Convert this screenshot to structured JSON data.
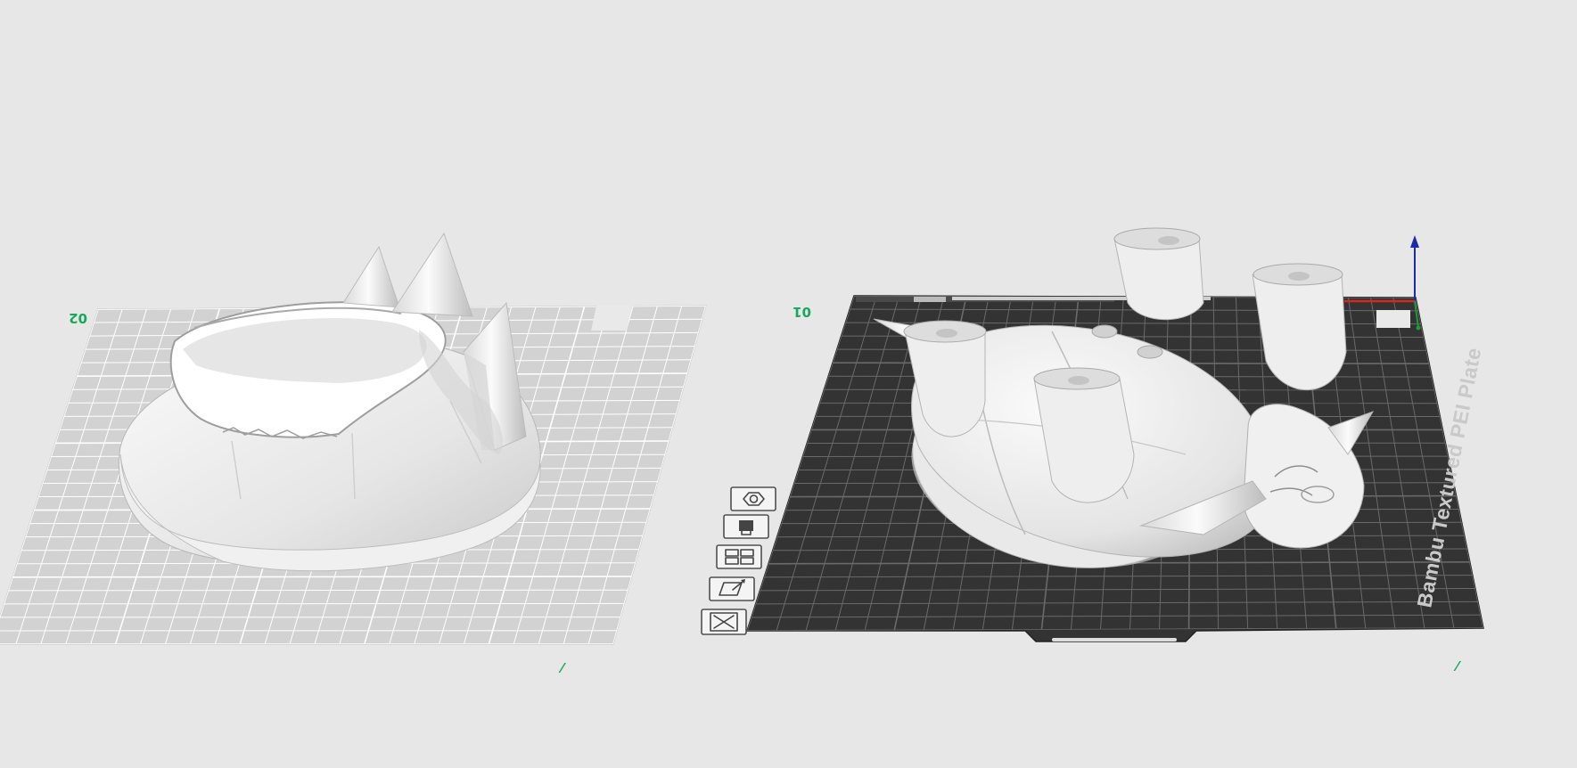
{
  "app": {
    "view": "3D prepare view"
  },
  "colors": {
    "background": "#e7e7e7",
    "plate_grey": "#d2d2d2",
    "plate_dark": "#333333",
    "plate_grid_light": "#ffffff",
    "plate_grid_dark": "#6a6a6a",
    "label_green": "#17a85a",
    "model": "#eaeaea",
    "axis_x": "#d42a1e",
    "axis_y": "#1f9a3a",
    "axis_z": "#1a2aa8"
  },
  "plates": [
    {
      "index_label": "02",
      "corner_label": "⁄",
      "state": "inactive",
      "model": "crown-shell"
    },
    {
      "index_label": "01",
      "corner_label": "⁄",
      "state": "active",
      "brand_text": "Bambu Textured PEI Plate",
      "model": "shell-body-with-legs"
    }
  ],
  "plate_toolbar": [
    {
      "icon": "arrange-icon",
      "label": "Arrange"
    },
    {
      "icon": "lock-icon",
      "label": "Lock"
    },
    {
      "icon": "settings-icon",
      "label": "Plate settings"
    },
    {
      "icon": "auto-orient-icon",
      "label": "Auto orient"
    },
    {
      "icon": "close-icon",
      "label": "Delete plate"
    }
  ],
  "axes": [
    "x",
    "y",
    "z"
  ]
}
